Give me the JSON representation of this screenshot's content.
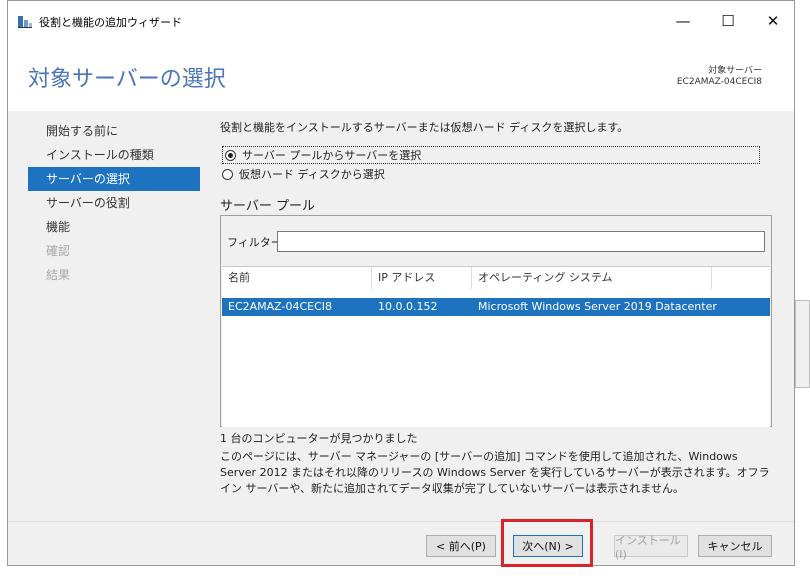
{
  "window": {
    "title": "役割と機能の追加ウィザード",
    "controls": {
      "minimize": "—",
      "maximize": "☐",
      "close": "✕"
    }
  },
  "header": {
    "heading": "対象サーバーの選択",
    "destination_label": "対象サーバー",
    "destination_server": "EC2AMAZ-04CECI8"
  },
  "nav": {
    "items": [
      {
        "label": "開始する前に",
        "state": "normal"
      },
      {
        "label": "インストールの種類",
        "state": "normal"
      },
      {
        "label": "サーバーの選択",
        "state": "active"
      },
      {
        "label": "サーバーの役割",
        "state": "normal"
      },
      {
        "label": "機能",
        "state": "normal"
      },
      {
        "label": "確認",
        "state": "disabled"
      },
      {
        "label": "結果",
        "state": "disabled"
      }
    ]
  },
  "content": {
    "description": "役割と機能をインストールするサーバーまたは仮想ハード ディスクを選択します。",
    "radio_pool": "サーバー プールからサーバーを選択",
    "radio_vhd": "仮想ハード ディスクから選択",
    "pool_heading": "サーバー プール",
    "filter_label": "フィルター:",
    "filter_value": "",
    "columns": {
      "name": "名前",
      "ip": "IP アドレス",
      "os": "オペレーティング システム"
    },
    "rows": [
      {
        "name": "EC2AMAZ-04CECI8",
        "ip": "10.0.0.152",
        "os": "Microsoft Windows Server 2019 Datacenter"
      }
    ],
    "found_text": "1 台のコンピューターが見つかりました",
    "info_text": "このページには、サーバー マネージャーの [サーバーの追加] コマンドを使用して追加された、Windows Server 2012 またはそれ以降のリリースの Windows Server を実行しているサーバーが表示されます。オフライン サーバーや、新たに追加されてデータ収集が完了していないサーバーは表示されません。"
  },
  "footer": {
    "prev": "< 前へ(P)",
    "next": "次へ(N) >",
    "install": "インストール(I)",
    "cancel": "キャンセル"
  },
  "colors": {
    "accent": "#1e73c0",
    "heading": "#4a75b7",
    "highlight": "#d9232a"
  }
}
